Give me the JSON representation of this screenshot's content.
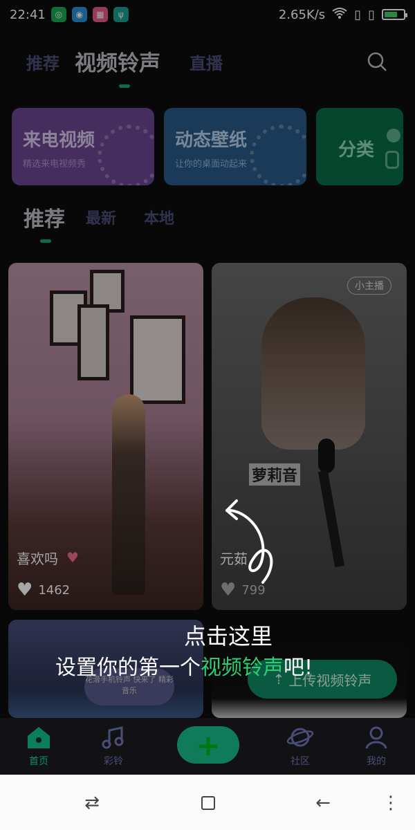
{
  "statusbar": {
    "time": "22:41",
    "speed": "2.65K/s"
  },
  "top_tabs": {
    "recommend": "推荐",
    "video_ringtone": "视频铃声",
    "live": "直播"
  },
  "feature_cards": [
    {
      "title": "来电视频",
      "subtitle": "精选来电视频秀",
      "color": "#6f4a9a"
    },
    {
      "title": "动态壁纸",
      "subtitle": "让你的桌面动起来",
      "color": "#2a5f8a"
    },
    {
      "title": "分类",
      "subtitle": "",
      "color": "#0e6e4a"
    }
  ],
  "sub_tabs": {
    "recommend": "推荐",
    "latest": "最新",
    "local": "本地"
  },
  "videos": [
    {
      "caption": "喜欢吗",
      "likes": "1462"
    },
    {
      "caption": "元茹",
      "likes": "799",
      "badge": "小主播",
      "overlay_text": "萝莉音"
    }
  ],
  "hint": {
    "line1": "点击这里",
    "line2_prefix": "设置你的第一个",
    "line2_green": "视频铃声",
    "line2_suffix": "吧!"
  },
  "upload_button": "上传视频铃声",
  "promo_text": "花滑手机铃声 快来了 精彩音乐",
  "bottom_nav": {
    "home": "首页",
    "music": "彩铃",
    "community": "社区",
    "mine": "我的"
  },
  "colors": {
    "accent": "#14a37c",
    "inactive": "#4a4d78"
  }
}
